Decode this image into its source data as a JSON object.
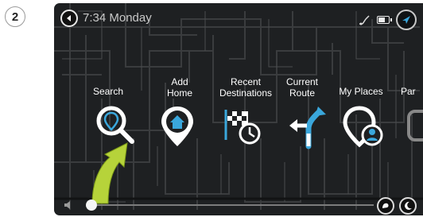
{
  "step_badge": "2",
  "status": {
    "time_day": "7:34 Monday"
  },
  "menu": {
    "items": [
      {
        "id": "search",
        "label": "Search",
        "icon": "search-icon"
      },
      {
        "id": "add-home",
        "label": "Add\nHome",
        "icon": "home-pin-icon"
      },
      {
        "id": "recent",
        "label": "Recent\nDestinations",
        "icon": "recent-destinations-icon"
      },
      {
        "id": "current-route",
        "label": "Current\nRoute",
        "icon": "current-route-icon"
      },
      {
        "id": "my-places",
        "label": "My Places",
        "icon": "my-places-icon"
      },
      {
        "id": "parking",
        "label": "Par",
        "icon": "parking-icon"
      }
    ]
  },
  "colors": {
    "screen_bg": "#1e2022",
    "accent_blue": "#3aa7dc",
    "arrow_green": "#b6d33a"
  },
  "volume": {
    "level": 0.0
  }
}
